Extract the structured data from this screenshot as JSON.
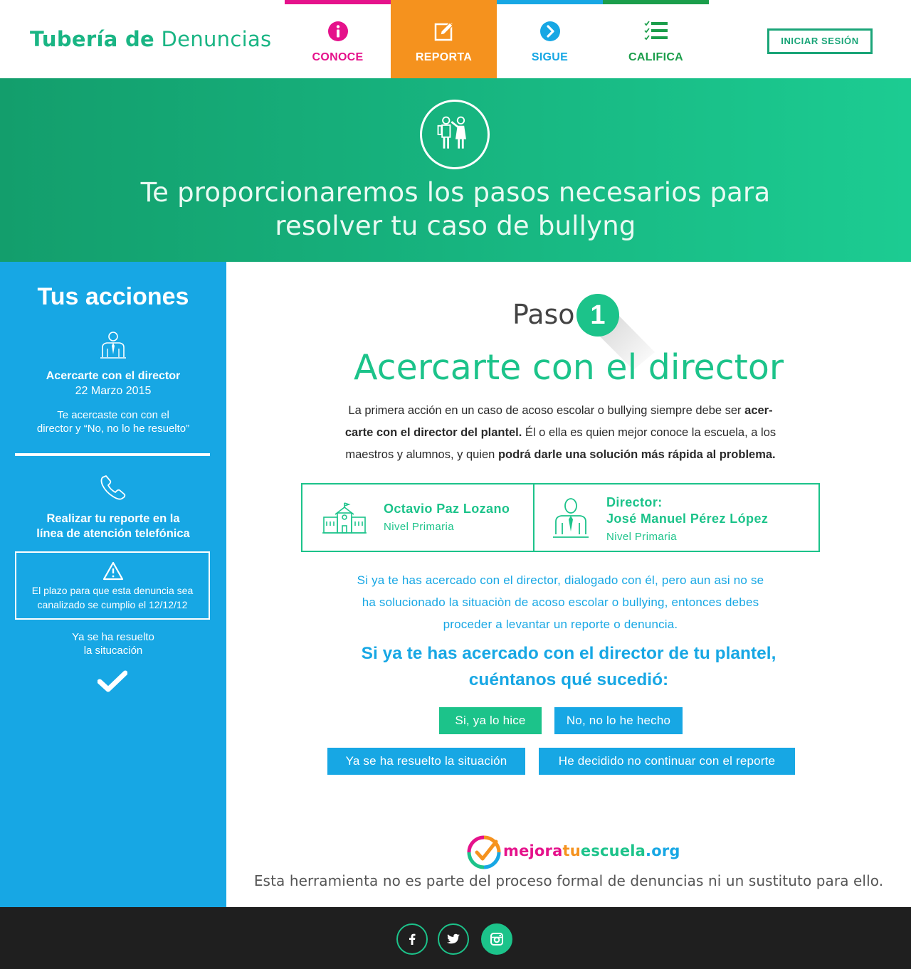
{
  "header": {
    "logo_bold": "Tubería de",
    "logo_light": "Denuncias",
    "login_label": "INICIAR SESIÓN"
  },
  "nav": [
    {
      "label": "CONOCE",
      "icon": "info-icon",
      "color": "#e5128b"
    },
    {
      "label": "REPORTA",
      "icon": "edit-icon",
      "color": "#f5921e",
      "active": true
    },
    {
      "label": "SIGUE",
      "icon": "chevron-right-icon",
      "color": "#17a7e4"
    },
    {
      "label": "CALIFICA",
      "icon": "checklist-icon",
      "color": "#1b9e4b"
    }
  ],
  "hero": {
    "icon": "bullying-icon",
    "title_line1": "Te proporcionaremos los pasos necesarios para",
    "title_line2": "resolver tu caso de bullyng"
  },
  "sidebar": {
    "title": "Tus acciones",
    "action1": {
      "icon": "director-icon",
      "title": "Acercarte con el director",
      "date": "22 Marzo 2015",
      "note_line1": "Te acercaste con con el",
      "note_line2": "director y “No, no lo he resuelto”"
    },
    "action2": {
      "icon": "phone-icon",
      "title_line1": "Realizar tu reporte en la",
      "title_line2": "línea de atención telefónica",
      "warning_icon": "warning-icon",
      "warning_line1": "El plazo para que esta denuncia sea",
      "warning_line2": "canalizado se cumplio el 12/12/12"
    },
    "action3": {
      "line1": "Ya se ha resuelto",
      "line2": "la situcación",
      "icon": "check-icon"
    }
  },
  "main": {
    "paso_label": "Paso",
    "paso_number": "1",
    "step_title": "Acercarte con el director",
    "intro": {
      "p1": "La primera acción en un caso de acoso escolar o bullying siempre debe ser ",
      "b1": "acer-",
      "b2": "carte con el director del plantel.",
      "p2": " Él o ella es quien mejor conoce la escuela, a los",
      "p3": "maestros y alumnos, y quien ",
      "b3": "podrá darle una solución más rápida al problema."
    },
    "school": {
      "icon": "school-icon",
      "name": "Octavio Paz Lozano",
      "level": "Nivel Primaria"
    },
    "director": {
      "icon": "director-icon",
      "label": "Director:",
      "name": "José Manuel Pérez López",
      "level": "Nivel Primaria"
    },
    "info_line1": "Si ya te has acercado con el director, dialogado con él, pero aun asi no se",
    "info_line2": "ha solucionado la situaciòn de acoso escolar o bullying, entonces debes",
    "info_line3": "proceder a levantar un reporte o denuncia.",
    "ask_line1": "Si ya te has acercado con el director de tu plantel,",
    "ask_line2": "cuéntanos qué sucedió:",
    "buttons": {
      "yes": "Si, ya lo hice",
      "no": "No, no lo he hecho",
      "resolved": "Ya se ha resuelto la situación",
      "stop": "He decidido no continuar con el reporte"
    },
    "brand": {
      "icon": "mejoratuescuela-logo-icon",
      "part1": "mejora",
      "part2": "tu",
      "part3": "escuela",
      "part4": ".org"
    },
    "disclaimer": "Esta herramienta no es parte del proceso formal de denuncias ni un sustituto para ello."
  },
  "footer": {
    "social": [
      "facebook-icon",
      "twitter-icon",
      "instagram-icon"
    ]
  },
  "colors": {
    "green": "#1cc38a",
    "blue": "#17a7e4",
    "orange": "#f5921e",
    "pink": "#e5128b",
    "dark_green": "#1b9e4b",
    "footer": "#1f1f1f"
  }
}
